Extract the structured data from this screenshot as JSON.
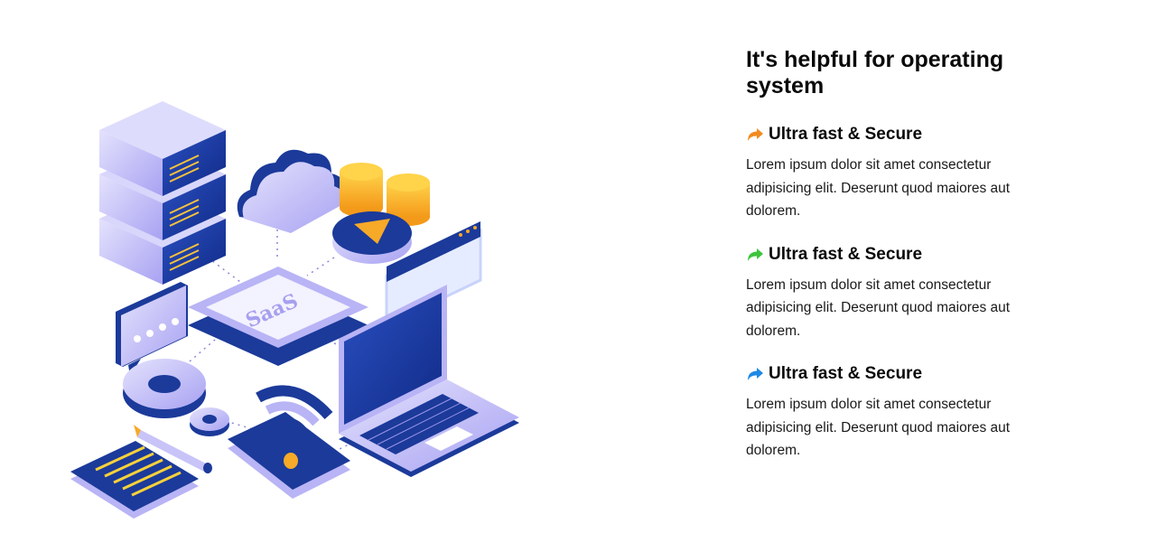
{
  "heading": "It's helpful for operating system",
  "illustration": {
    "label": "SaaS"
  },
  "features": [
    {
      "title": "Ultra fast & Secure",
      "description": "Lorem ipsum dolor sit amet consectetur adipisicing elit. Deserunt quod maiores aut dolorem.",
      "icon": "share-arrow-icon",
      "icon_color": "#f28a1e"
    },
    {
      "title": "Ultra fast & Secure",
      "description": "Lorem ipsum dolor sit amet consectetur adipisicing elit. Deserunt quod maiores aut dolorem.",
      "icon": "share-arrow-icon",
      "icon_color": "#3cc43c"
    },
    {
      "title": "Ultra fast & Secure",
      "description": "Lorem ipsum dolor sit amet consectetur adipisicing elit. Deserunt quod maiores aut dolorem.",
      "icon": "share-arrow-icon",
      "icon_color": "#1e88e5"
    }
  ],
  "colors": {
    "navy": "#1b3a9a",
    "lavender": "#b9b4f5",
    "light_lavender": "#dcdcfb",
    "gold": "#f7a928"
  }
}
